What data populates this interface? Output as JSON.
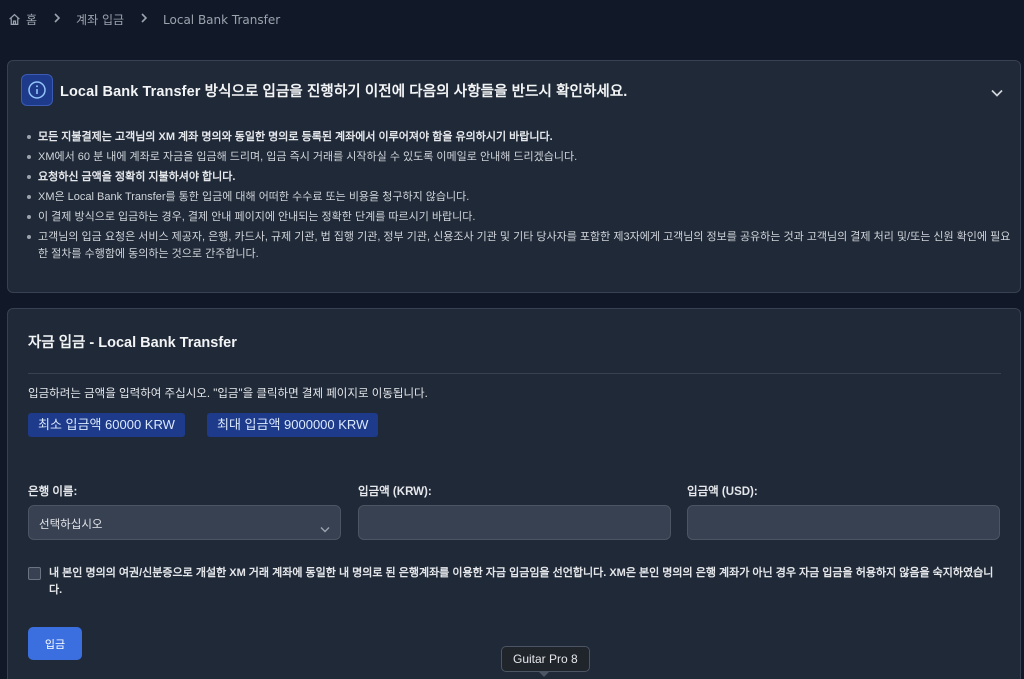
{
  "breadcrumb": {
    "home": "홈",
    "items": [
      "계좌 입금",
      "Local Bank Transfer"
    ]
  },
  "notice": {
    "title": "Local Bank Transfer 방식으로 입금을 진행하기 이전에 다음의 사항들을 반드시 확인하세요.",
    "items": [
      "모든 지불결제는 고객님의 XM 계좌 명의와 동일한 명의로 등록된 계좌에서 이루어져야 함을 유의하시기 바랍니다.",
      "XM에서 60 분 내에 계좌로 자금을 입금해 드리며, 입금 즉시 거래를 시작하실 수 있도록 이메일로 안내해 드리겠습니다.",
      "요청하신 금액을 정확히 지불하셔야 합니다.",
      "XM은 Local Bank Transfer를 통한 입금에 대해 어떠한 수수료 또는 비용을 청구하지 않습니다.",
      "이 결제 방식으로 입금하는 경우, 결제 안내 페이지에 안내되는 정확한 단계를 따르시기 바랍니다.",
      "고객님의 입금 요청은 서비스 제공자, 은행, 카드사, 규제 기관, 법 집행 기관, 정부 기관, 신용조사 기관 및 기타 당사자를 포함한 제3자에게 고객님의 정보를 공유하는 것과 고객님의 결제 처리 및/또는 신원 확인에 필요한 절차를 수행함에 동의하는 것으로 간주합니다."
    ]
  },
  "deposit": {
    "title": "자금 입금 - Local Bank Transfer",
    "instruction": "입금하려는 금액을 입력하여 주십시오. \"입금\"을 클릭하면 결제 페이지로 이동됩니다.",
    "min_badge": "최소 입금액 60000 KRW",
    "max_badge": "최대 입금액 9000000 KRW",
    "bank_label": "은행 이름:",
    "bank_placeholder": "선택하십시오",
    "krw_label": "입금액 (KRW):",
    "usd_label": "입금액 (USD):",
    "krw_value": "",
    "usd_value": "",
    "consent_text": "내 본인 명의의 여권/신분증으로 개설한 XM 거래 계좌에 동일한 내 명의로 된 은행계좌를 이용한 자금 입금임을 선언합니다. XM은 본인 명의의 은행 계좌가 아닌 경우 자금 입금을 허용하지 않음을 숙지하였습니다.",
    "submit_label": "입금"
  },
  "tooltip": {
    "text": "Guitar Pro 8"
  },
  "colors": {
    "background": "#111827",
    "card": "#1f2937",
    "accent": "#3b6fe0",
    "badge": "#1e3a8a"
  },
  "icons": [
    "home-icon",
    "info-icon",
    "chevron-down-icon",
    "chevron-right-icon"
  ]
}
